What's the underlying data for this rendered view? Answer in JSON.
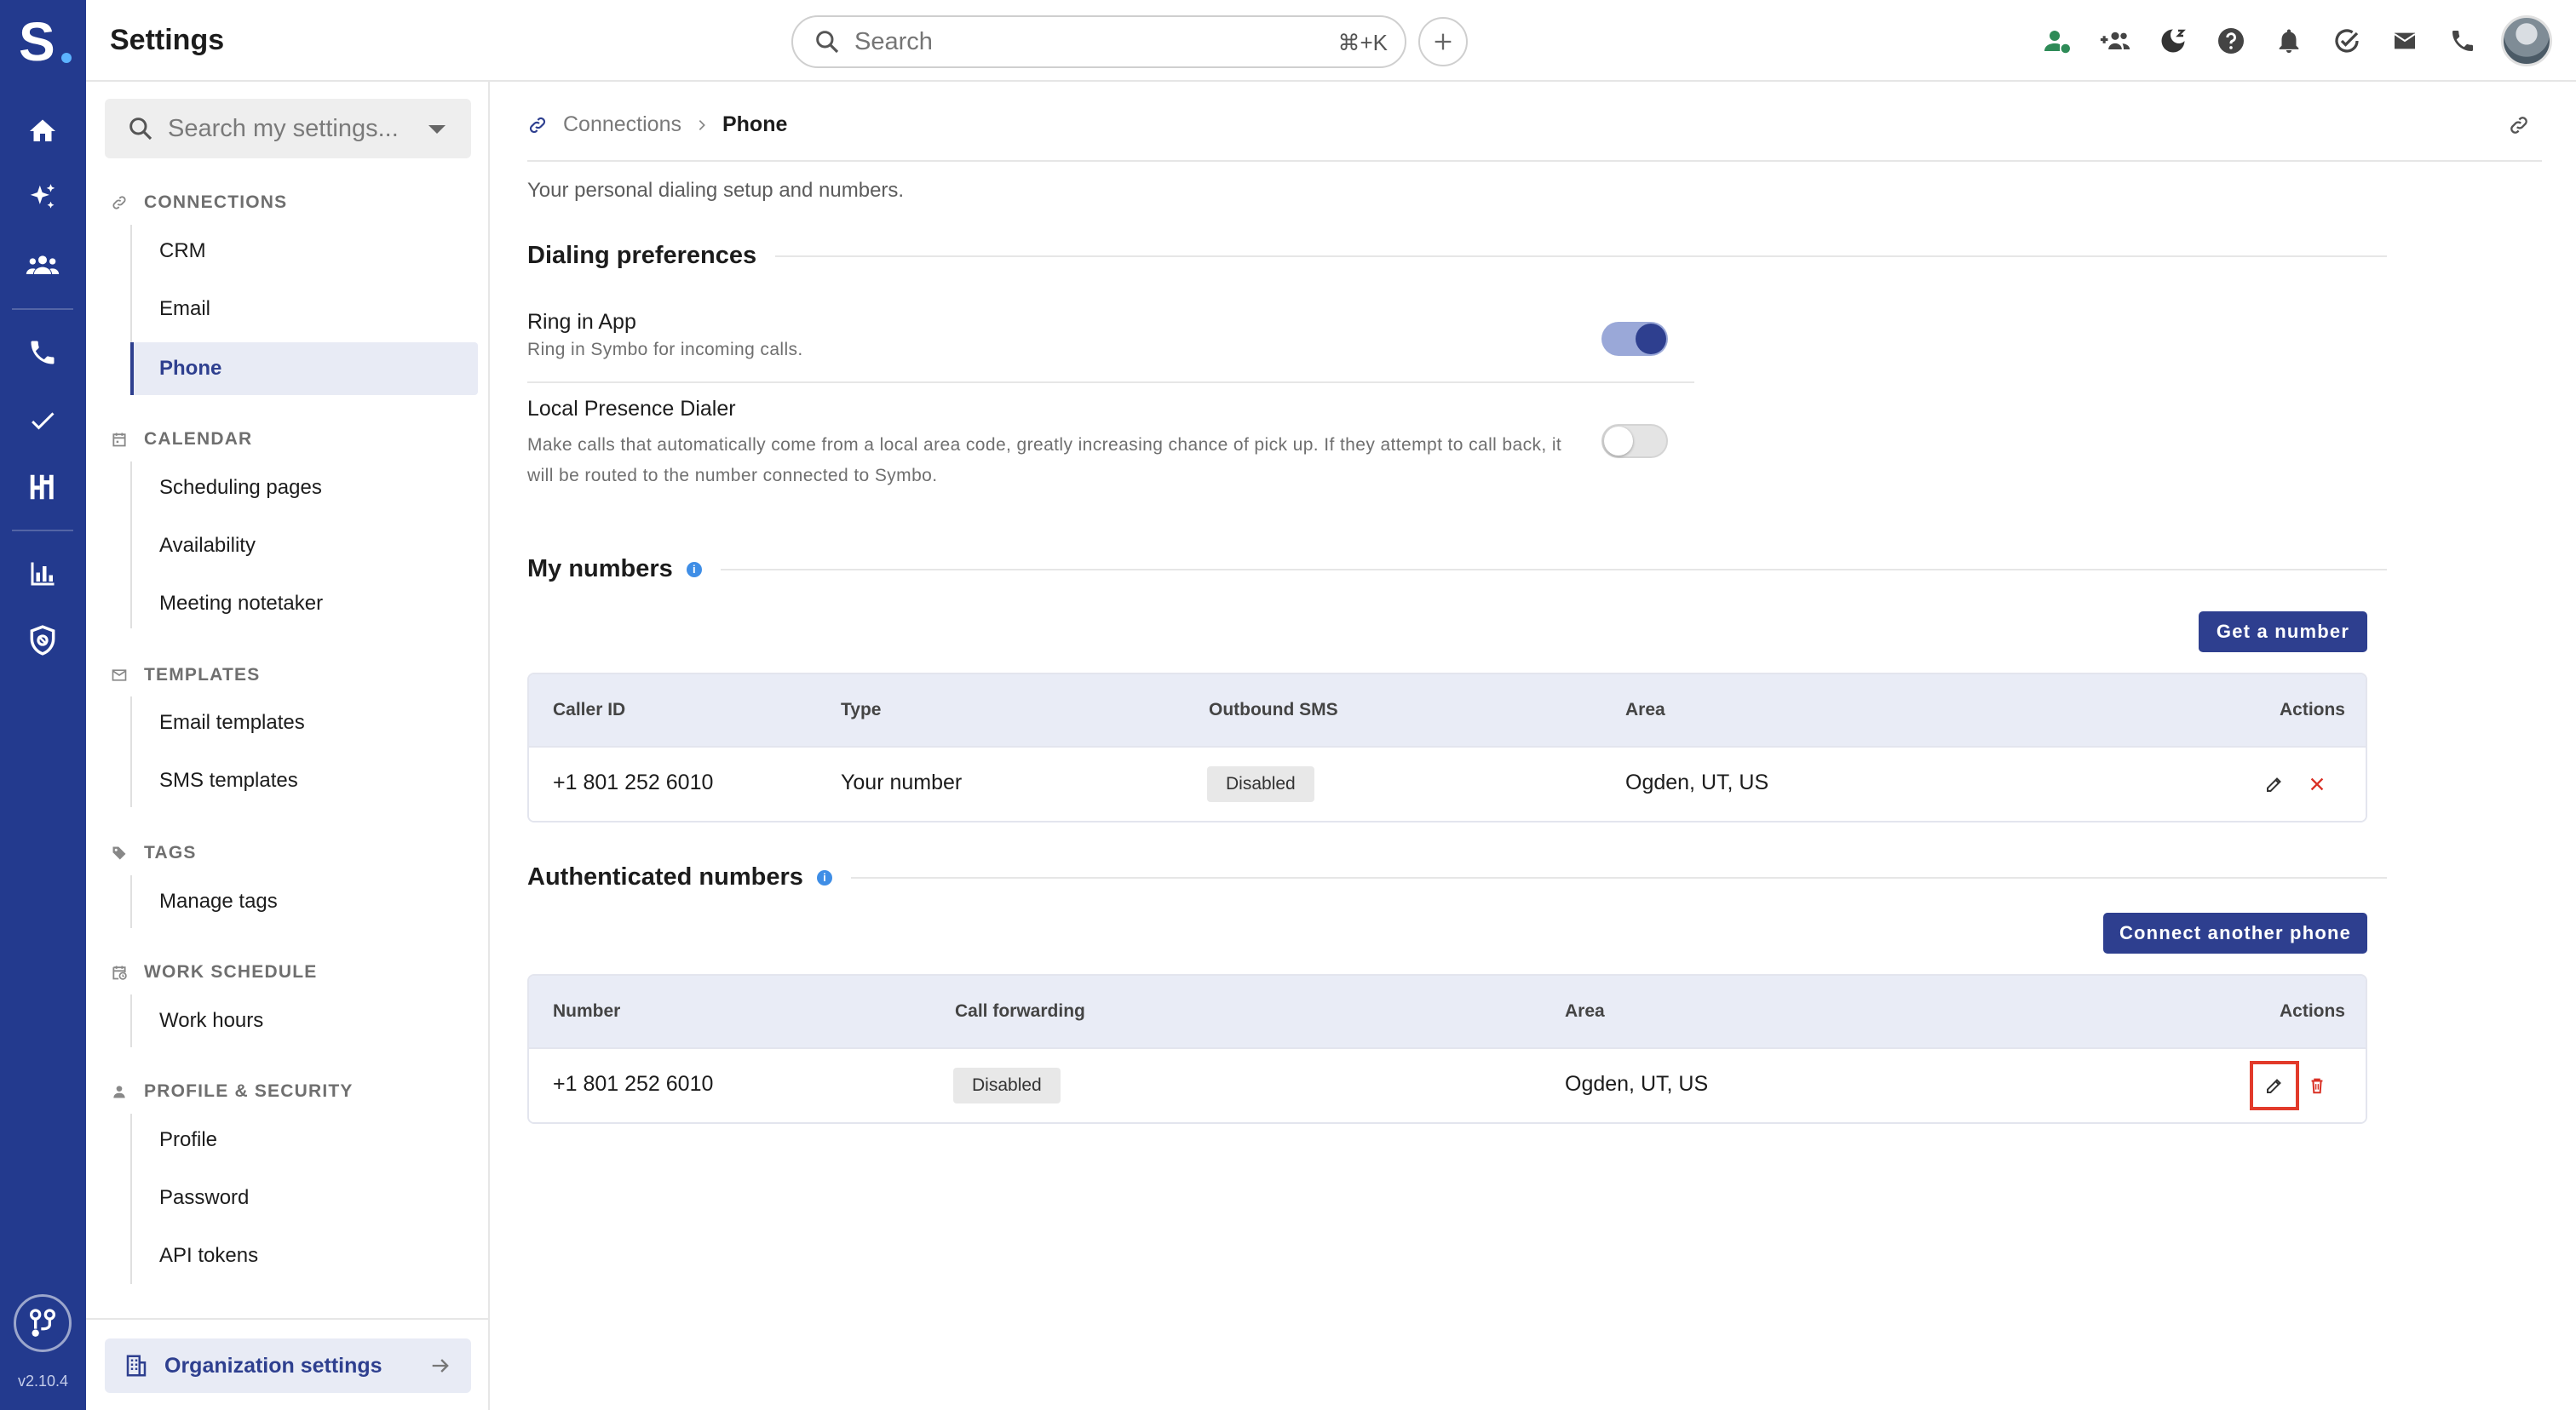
{
  "app": {
    "logo_letter": "S",
    "version": "v2.10.4",
    "rail_icons": [
      "home-icon",
      "sparkle-icon",
      "team-icon",
      "phone-icon",
      "check-icon",
      "pipeline-icon",
      "bar-chart-icon",
      "shield-icon"
    ]
  },
  "topbar": {
    "title": "Settings",
    "search_placeholder": "Search",
    "search_shortcut": "⌘+K",
    "icons": [
      "user-status-icon",
      "add-people-icon",
      "do-not-disturb-icon",
      "help-icon",
      "bell-icon",
      "check-circle-icon",
      "mail-icon",
      "phone-icon"
    ]
  },
  "sidebar": {
    "search_placeholder": "Search my settings...",
    "sections": [
      {
        "title": "CONNECTIONS",
        "icon": "link-icon",
        "items": [
          "CRM",
          "Email",
          "Phone"
        ]
      },
      {
        "title": "CALENDAR",
        "icon": "calendar-icon",
        "items": [
          "Scheduling pages",
          "Availability",
          "Meeting notetaker"
        ]
      },
      {
        "title": "TEMPLATES",
        "icon": "mail-outline-icon",
        "items": [
          "Email templates",
          "SMS templates"
        ]
      },
      {
        "title": "TAGS",
        "icon": "tag-icon",
        "items": [
          "Manage tags"
        ]
      },
      {
        "title": "WORK SCHEDULE",
        "icon": "calendar-clock-icon",
        "items": [
          "Work hours"
        ]
      },
      {
        "title": "PROFILE & SECURITY",
        "icon": "person-icon",
        "items": [
          "Profile",
          "Password",
          "API tokens"
        ]
      }
    ],
    "active_item": "Phone",
    "org_settings_label": "Organization settings"
  },
  "breadcrumb": {
    "parent": "Connections",
    "current": "Phone"
  },
  "page": {
    "subtitle": "Your personal dialing setup and numbers.",
    "dialing": {
      "heading": "Dialing preferences",
      "prefs": [
        {
          "title": "Ring in App",
          "desc": "Ring in Symbo for incoming calls.",
          "enabled": true
        },
        {
          "title": "Local Presence Dialer",
          "desc": "Make calls that automatically come from a local area code, greatly increasing chance of pick up. If they attempt to call back, it will be routed to the number connected to Symbo.",
          "enabled": false
        }
      ]
    },
    "my_numbers": {
      "heading": "My numbers",
      "button": "Get a number",
      "columns": [
        "Caller ID",
        "Type",
        "Outbound SMS",
        "Area",
        "Actions"
      ],
      "rows": [
        {
          "caller_id": "+1 801 252 6010",
          "type": "Your number",
          "outbound_sms": "Disabled",
          "area": "Ogden, UT, US"
        }
      ]
    },
    "auth_numbers": {
      "heading": "Authenticated numbers",
      "button": "Connect another phone",
      "columns": [
        "Number",
        "Call forwarding",
        "Area",
        "Actions"
      ],
      "rows": [
        {
          "number": "+1 801 252 6010",
          "call_forwarding": "Disabled",
          "area": "Ogden, UT, US"
        }
      ]
    }
  },
  "colors": {
    "rail": "#233a8e",
    "primary": "#2e3f8f",
    "danger": "#d93025",
    "info": "#3f8ee6",
    "status_green": "#2e8b57"
  }
}
